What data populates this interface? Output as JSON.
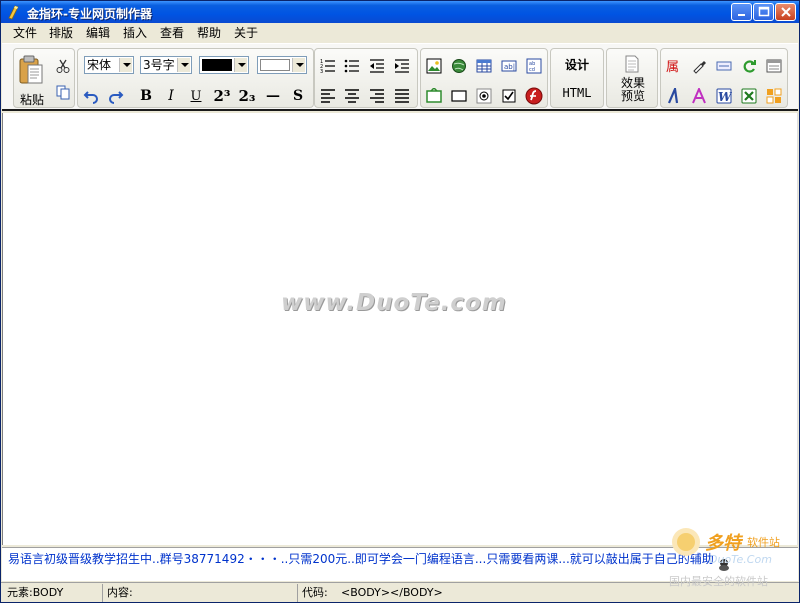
{
  "window": {
    "title": "金指环-专业网页制作器"
  },
  "menu": [
    "文件",
    "排版",
    "编辑",
    "插入",
    "查看",
    "帮助",
    "关于"
  ],
  "toolbar": {
    "paste_label": "粘贴",
    "font_family": "宋体",
    "font_size": "3号字",
    "fore_color": "#000000",
    "back_color": "#ffffff",
    "bold": "B",
    "italic": "I",
    "underline": "U",
    "superscript": "2³",
    "subscript": "2₃",
    "hr": "—",
    "strike": "S",
    "design_label": "设计",
    "html_label": "HTML",
    "preview_label": "效果\n预览"
  },
  "editor": {
    "watermark": "www.DuoTe.com"
  },
  "ticker": {
    "text": "易语言初级晋级教学招生中..群号38771492・・・..只需200元..即可学会一门编程语言...只需要看两课...就可以敲出属于自己的辅助"
  },
  "status": {
    "element_label": "元素:BODY",
    "content_label": "内容:",
    "code_label": "代码:",
    "code_value": "<BODY></BODY>"
  },
  "brand": {
    "name": "多特",
    "sub": "软件站",
    "url": "DuoTe.Com",
    "tagline": "国内最安全的软件站"
  },
  "colors": {
    "titlebar": "#0054e3",
    "ticker_text": "#0033cc",
    "accent": "#f0a020"
  }
}
